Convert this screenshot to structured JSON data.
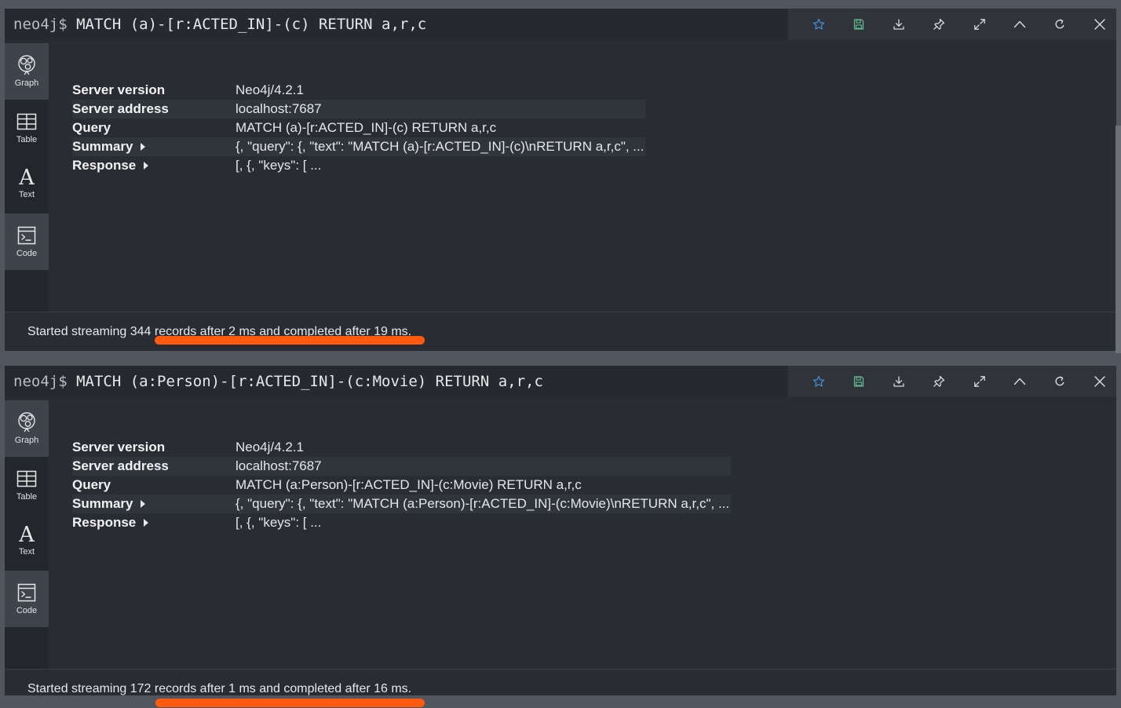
{
  "frames": [
    {
      "prompt": "neo4j$",
      "query": "MATCH (a)-[r:ACTED_IN]-(c) RETURN a,r,c",
      "meta": {
        "server_version_label": "Server version",
        "server_version": "Neo4j/4.2.1",
        "server_address_label": "Server address",
        "server_address": "localhost:7687",
        "query_label": "Query",
        "query_value": "MATCH (a)-[r:ACTED_IN]-(c) RETURN a,r,c",
        "summary_label": "Summary",
        "summary_value": "{, \"query\": {, \"text\": \"MATCH (a)-[r:ACTED_IN]-(c)\\nRETURN a,r,c\", ...",
        "response_label": "Response",
        "response_value": "[, {, \"keys\": [ ..."
      },
      "status": "Started streaming 344 records after 2 ms and completed after 19 ms."
    },
    {
      "prompt": "neo4j$",
      "query": "MATCH (a:Person)-[r:ACTED_IN]-(c:Movie) RETURN a,r,c",
      "meta": {
        "server_version_label": "Server version",
        "server_version": "Neo4j/4.2.1",
        "server_address_label": "Server address",
        "server_address": "localhost:7687",
        "query_label": "Query",
        "query_value": "MATCH (a:Person)-[r:ACTED_IN]-(c:Movie) RETURN a,r,c",
        "summary_label": "Summary",
        "summary_value": "{, \"query\": {, \"text\": \"MATCH (a:Person)-[r:ACTED_IN]-(c:Movie)\\nRETURN a,r,c\", ...",
        "response_label": "Response",
        "response_value": "[, {, \"keys\": [ ..."
      },
      "status": "Started streaming 172 records after 1 ms and completed after 16 ms."
    }
  ],
  "sidebar_tabs": [
    "Graph",
    "Table",
    "Text",
    "Code"
  ],
  "active_tab": "Code",
  "icons": {
    "actions": [
      "star-icon",
      "save-icon",
      "download-icon",
      "pin-icon",
      "expand-icon",
      "collapse-icon",
      "rerun-icon",
      "close-icon"
    ]
  },
  "colors": {
    "accent_star": "#428bca",
    "accent_save": "#5fb58d",
    "highlight_underline": "#ff5a10"
  }
}
